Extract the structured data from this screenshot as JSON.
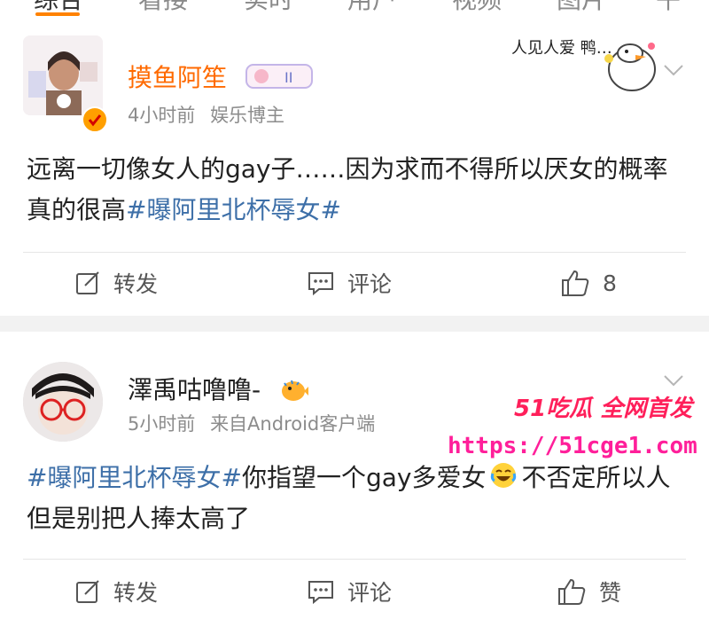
{
  "tabs": [
    "综合",
    "看接",
    "实时",
    "用户",
    "视频",
    "图片",
    "午"
  ],
  "posts": [
    {
      "username": "摸鱼阿笙",
      "level_badge": "II",
      "time": "4小时前",
      "source": "娱乐博主",
      "text_plain": "远离一切像女人的gay子……因为求而不得所以厌女的概率真的很高",
      "topic": "#曝阿里北杯辱女#",
      "actions": {
        "repost": "转发",
        "comment": "评论",
        "like": "8"
      },
      "sticker_text": "人见人爱 鸭…"
    },
    {
      "username": "澤禹咕噜噜-",
      "time": "5小时前",
      "source": "来自Android客户端",
      "topic": "#曝阿里北杯辱女#",
      "text_a": "你指望一个gay多爱女",
      "text_b": "不否定所以人但是别把人捧太高了",
      "actions": {
        "repost": "转发",
        "comment": "评论",
        "like": "赞"
      }
    }
  ],
  "watermark": {
    "line1": "51吃瓜 全网首发",
    "line2": "https://51cge1.com"
  },
  "colors": {
    "accent": "#ff8200",
    "topic": "#3d6fa8",
    "watermark": "#ff1f5a"
  }
}
